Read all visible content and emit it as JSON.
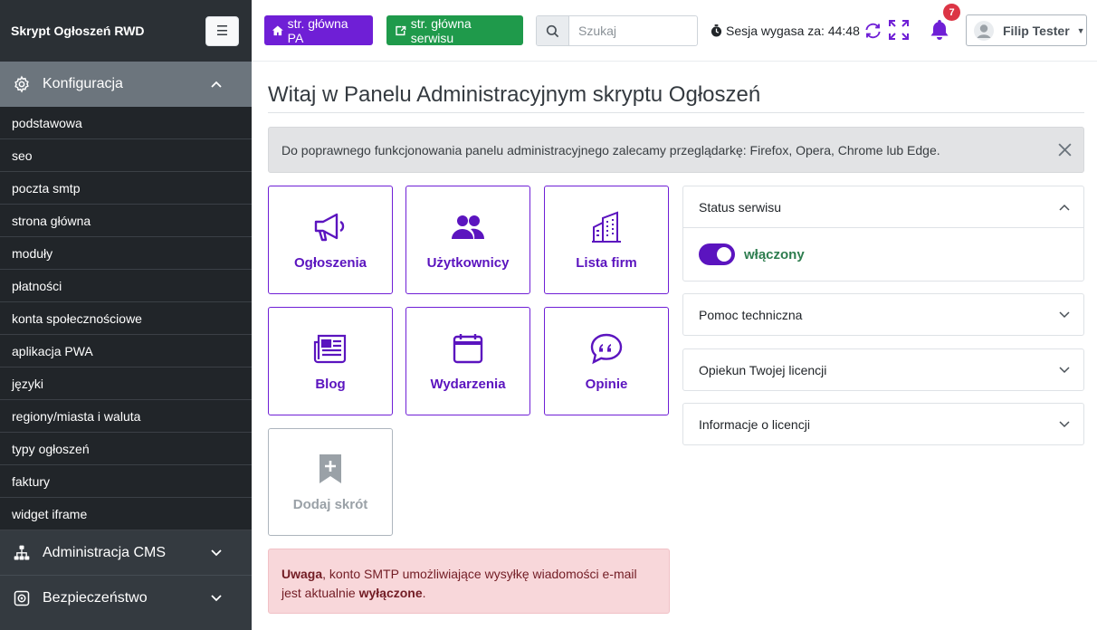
{
  "sidebar": {
    "brand": "Skrypt Ogłoszeń RWD",
    "sections": {
      "config": {
        "label": "Konfiguracja",
        "items": [
          "podstawowa",
          "seo",
          "poczta smtp",
          "strona główna",
          "moduły",
          "płatności",
          "konta społecznościowe",
          "aplikacja PWA",
          "języki",
          "regiony/miasta i waluta",
          "typy ogłoszeń",
          "faktury",
          "widget iframe"
        ]
      },
      "cms": {
        "label": "Administracja CMS"
      },
      "security": {
        "label": "Bezpieczeństwo"
      }
    }
  },
  "topbar": {
    "home_pa_label": "str. główna PA",
    "home_site_label": "str. główna serwisu",
    "search_placeholder": "Szukaj",
    "session_text": "Sesja wygasa za: 44:48",
    "notifications_count": "7",
    "user_name": "Filip Tester"
  },
  "main": {
    "title": "Witaj w Panelu Administracyjnym skryptu Ogłoszeń",
    "browser_notice": "Do poprawnego funkcjonowania panelu administracyjnego zalecamy przeglądarkę: Firefox, Opera, Chrome lub Edge.",
    "tiles": {
      "ads": "Ogłoszenia",
      "users": "Użytkownicy",
      "companies": "Lista firm",
      "blog": "Blog",
      "events": "Wydarzenia",
      "reviews": "Opinie",
      "add": "Dodaj skrót"
    },
    "alert": {
      "strong1": "Uwaga",
      "text": ", konto SMTP umożliwiające wysyłkę wiadomości e-mail jest aktualnie ",
      "strong2": "wyłączone",
      "end": "."
    },
    "panels": {
      "status": {
        "title": "Status serwisu",
        "value": "włączony",
        "enabled": true
      },
      "support": {
        "title": "Pomoc techniczna"
      },
      "license_keeper": {
        "title": "Opiekun Twojej licencji"
      },
      "license_info": {
        "title": "Informacje o licencji"
      }
    }
  },
  "colors": {
    "accent": "#6f1fd6",
    "success": "#1f9a4b",
    "sidebar": "#343a40",
    "danger": "#dc3545"
  }
}
